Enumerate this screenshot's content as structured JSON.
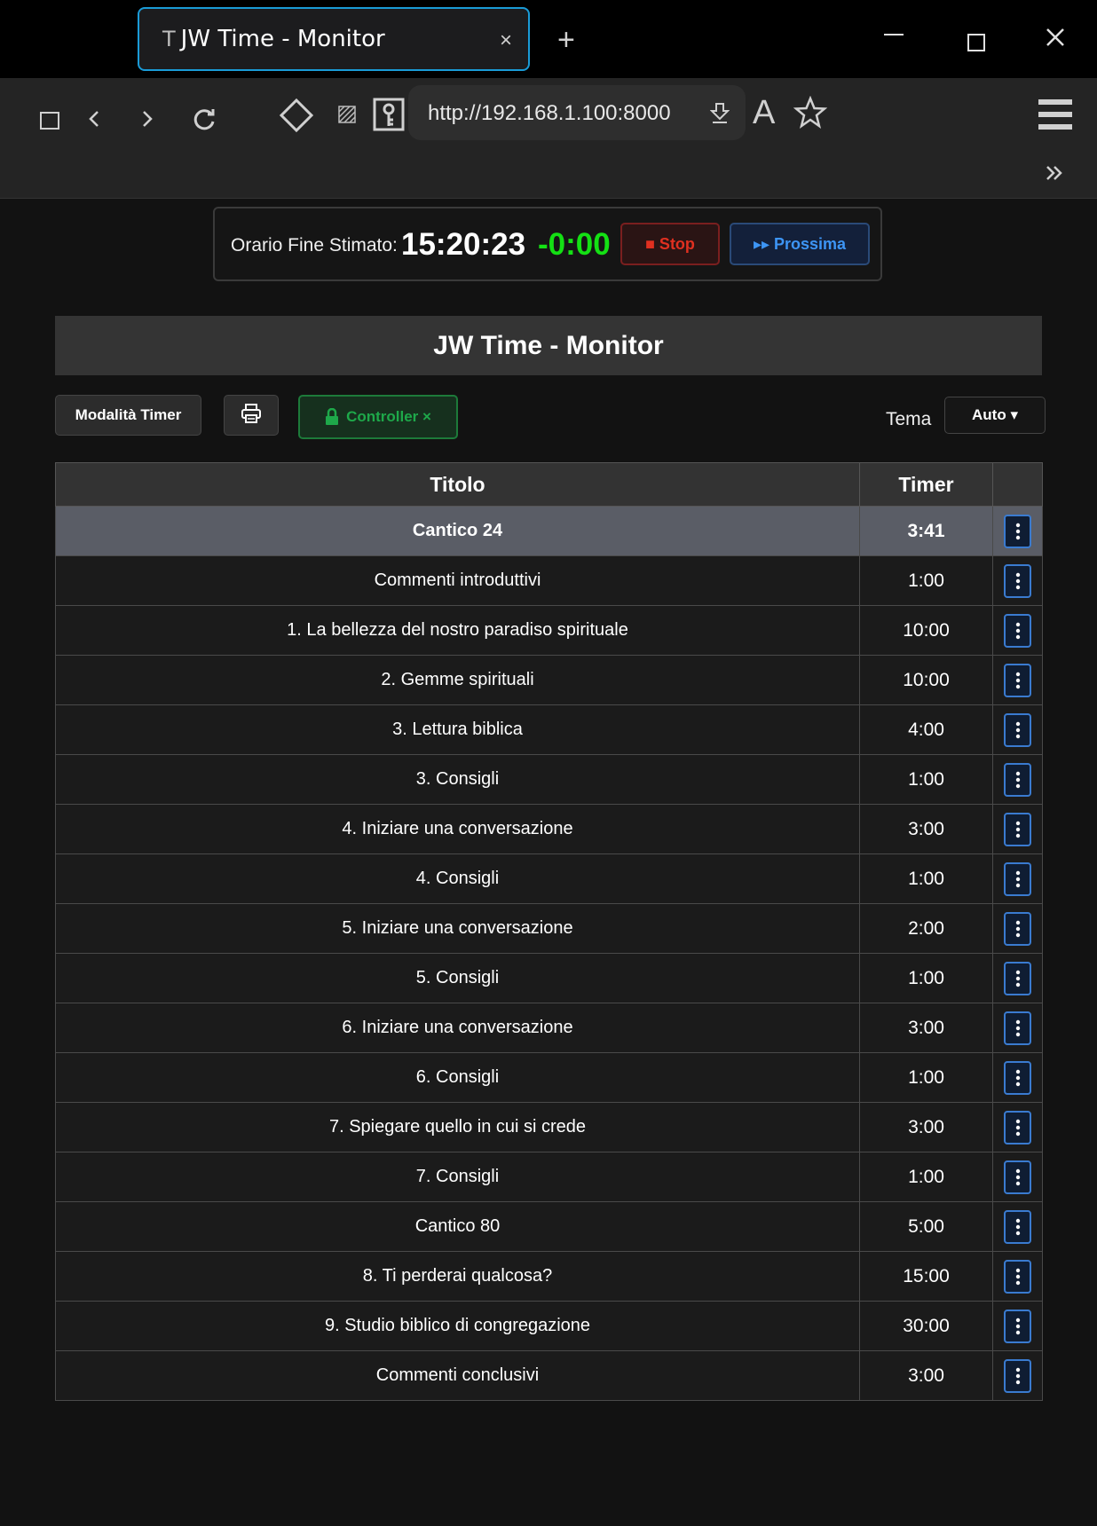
{
  "browser": {
    "tab_favicon": "T",
    "tab_title": "JW Time - Monitor",
    "tab_close": "×",
    "new_tab": "+",
    "url": "http://192.168.1.100:8000",
    "icons": [
      "sidebar-icon",
      "back-icon",
      "forward-icon",
      "reload-icon",
      "diamond-icon",
      "striped-icon",
      "key-icon",
      "download-icon",
      "reader-icon",
      "star-icon",
      "menu-icon",
      "overflow-icon"
    ]
  },
  "timer_bar": {
    "estimated_label": "Orario Fine Stimato:",
    "estimated_time": "15:20:23",
    "delta": "-0:00",
    "stop_label": "■ Stop",
    "next_label": "▸▸ Prossima"
  },
  "page": {
    "title": "JW Time - Monitor",
    "mode_button": "Modalità Timer",
    "controller_button": "Controller ×",
    "theme_label": "Tema",
    "theme_value": "Auto ▾"
  },
  "table": {
    "headers": {
      "title": "Titolo",
      "timer": "Timer"
    },
    "rows": [
      {
        "title": "Cantico 24",
        "timer": "3:41"
      },
      {
        "title": "Commenti introduttivi",
        "timer": "1:00"
      },
      {
        "title": "1. La bellezza del nostro paradiso spirituale",
        "timer": "10:00"
      },
      {
        "title": "2. Gemme spirituali",
        "timer": "10:00"
      },
      {
        "title": "3. Lettura biblica",
        "timer": "4:00"
      },
      {
        "title": "3. Consigli",
        "timer": "1:00"
      },
      {
        "title": "4. Iniziare una conversazione",
        "timer": "3:00"
      },
      {
        "title": "4. Consigli",
        "timer": "1:00"
      },
      {
        "title": "5. Iniziare una conversazione",
        "timer": "2:00"
      },
      {
        "title": "5. Consigli",
        "timer": "1:00"
      },
      {
        "title": "6. Iniziare una conversazione",
        "timer": "3:00"
      },
      {
        "title": "6. Consigli",
        "timer": "1:00"
      },
      {
        "title": "7. Spiegare quello in cui si crede",
        "timer": "3:00"
      },
      {
        "title": "7. Consigli",
        "timer": "1:00"
      },
      {
        "title": "Cantico 80",
        "timer": "5:00"
      },
      {
        "title": "8. Ti perderai qualcosa?",
        "timer": "15:00"
      },
      {
        "title": "9. Studio biblico di congregazione",
        "timer": "30:00"
      },
      {
        "title": "Commenti conclusivi",
        "timer": "3:00"
      }
    ]
  },
  "colors": {
    "accent_blue": "#1a9bd7",
    "delta_green": "#14e014",
    "stop_red": "#e03020",
    "next_blue": "#3d95f5",
    "controller_green": "#1ea84a",
    "active_row": "#5a5d66"
  }
}
